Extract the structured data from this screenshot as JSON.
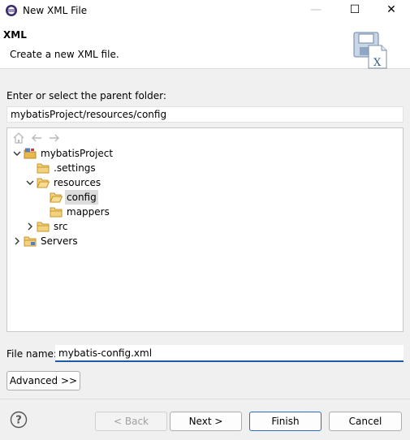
{
  "window": {
    "title": "New XML File",
    "controls": {
      "minimize": "—",
      "maximize": "☐",
      "close": "✕"
    }
  },
  "banner": {
    "title": "XML",
    "description": "Create a new XML file.",
    "icon": "xml-file-wizard-icon"
  },
  "parent_folder": {
    "label": "Enter or select the parent folder:",
    "value": "mybatisProject/resources/config"
  },
  "tree": {
    "toolbar": [
      "home-icon",
      "back-arrow-icon",
      "forward-arrow-icon"
    ],
    "items": [
      {
        "label": "mybatisProject",
        "expanded": true,
        "icon": "project-icon"
      },
      {
        "label": ".settings",
        "icon": "folder-icon"
      },
      {
        "label": "resources",
        "expanded": true,
        "icon": "folder-icon"
      },
      {
        "label": "config",
        "selected": true,
        "icon": "open-folder-icon"
      },
      {
        "label": "mappers",
        "icon": "folder-icon"
      },
      {
        "label": "src",
        "expanded": false,
        "icon": "folder-icon"
      },
      {
        "label": "Servers",
        "expanded": false,
        "icon": "folder-icon"
      }
    ]
  },
  "file_name": {
    "label": "File name:",
    "value": "mybatis-config.xml"
  },
  "advanced": {
    "label": "Advanced >>"
  },
  "footer": {
    "back": "< Back",
    "next": "Next >",
    "finish": "Finish",
    "cancel": "Cancel"
  },
  "colors": {
    "accent": "#1f5aa6",
    "folder": "#e8b84a",
    "selection": "#dcdcdc"
  }
}
